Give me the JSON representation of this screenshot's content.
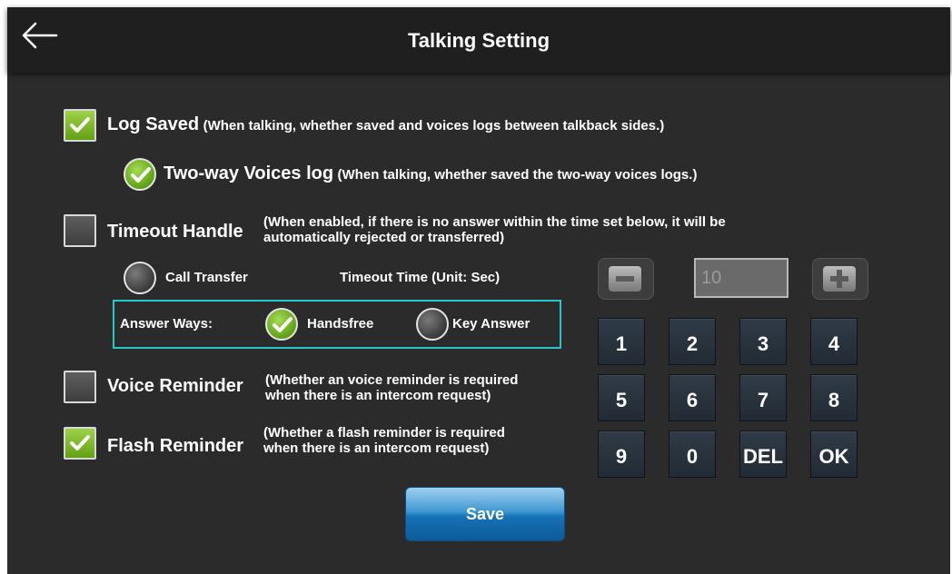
{
  "header": {
    "title": "Talking Setting",
    "back_icon": "arrow-left-icon"
  },
  "log_saved": {
    "checked": true,
    "label": "Log Saved",
    "desc": "(When talking, whether saved and voices logs between talkback sides.)"
  },
  "two_way": {
    "checked": true,
    "label": "Two-way Voices log",
    "desc": "(When talking, whether saved the two-way voices logs.)"
  },
  "timeout_handle": {
    "checked": false,
    "label": "Timeout Handle",
    "desc_line1": "(When enabled, if there is no answer within the time set below, it will be",
    "desc_line2": "automatically rejected or transferred)"
  },
  "call_transfer": {
    "selected": false,
    "label": "Call Transfer"
  },
  "timeout_time": {
    "label": "Timeout Time (Unit: Sec)",
    "value": "10"
  },
  "answer_ways": {
    "label": "Answer Ways:",
    "options": [
      {
        "label": "Handsfree",
        "selected": true
      },
      {
        "label": "Key Answer",
        "selected": false
      }
    ]
  },
  "voice_reminder": {
    "checked": false,
    "label": "Voice Reminder",
    "desc_line1": "(Whether an voice reminder is required",
    "desc_line2": "when there is an intercom request)"
  },
  "flash_reminder": {
    "checked": true,
    "label": "Flash Reminder",
    "desc_line1": "(Whether a flash reminder is required",
    "desc_line2": "when there is an intercom request)"
  },
  "keypad": {
    "keys": [
      "1",
      "2",
      "3",
      "4",
      "5",
      "6",
      "7",
      "8",
      "9",
      "0",
      "DEL",
      "OK"
    ]
  },
  "save_label": "Save",
  "colors": {
    "check_green": "#7bbf2a",
    "answer_border": "#27c6c9",
    "save_blue": "#1672b6"
  }
}
